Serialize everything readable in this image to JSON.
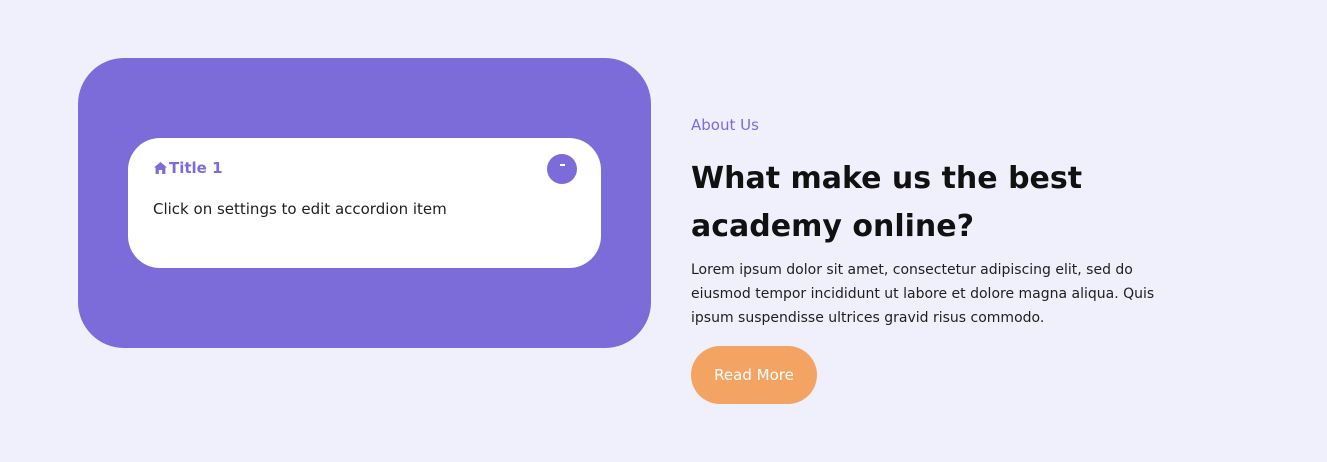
{
  "accordion": {
    "icon": "home-icon",
    "title": "Title 1",
    "toggle_icon": "minus-icon",
    "body": "Click on settings to edit accordion item"
  },
  "about": {
    "eyebrow": "About Us",
    "heading": "What make us the best academy online?",
    "paragraph": "Lorem ipsum dolor sit amet, consectetur adipiscing elit, sed do eiusmod tempor incididunt ut labore et dolore magna aliqua. Quis ipsum suspendisse ultrices gravid risus commodo.",
    "button_label": "Read More"
  },
  "colors": {
    "page_background": "#f0effc",
    "accent_purple": "#7b6cd9",
    "card_background": "#ffffff",
    "button_orange": "#f4a462",
    "heading_text": "#111111",
    "body_text": "#1f1f1f"
  }
}
